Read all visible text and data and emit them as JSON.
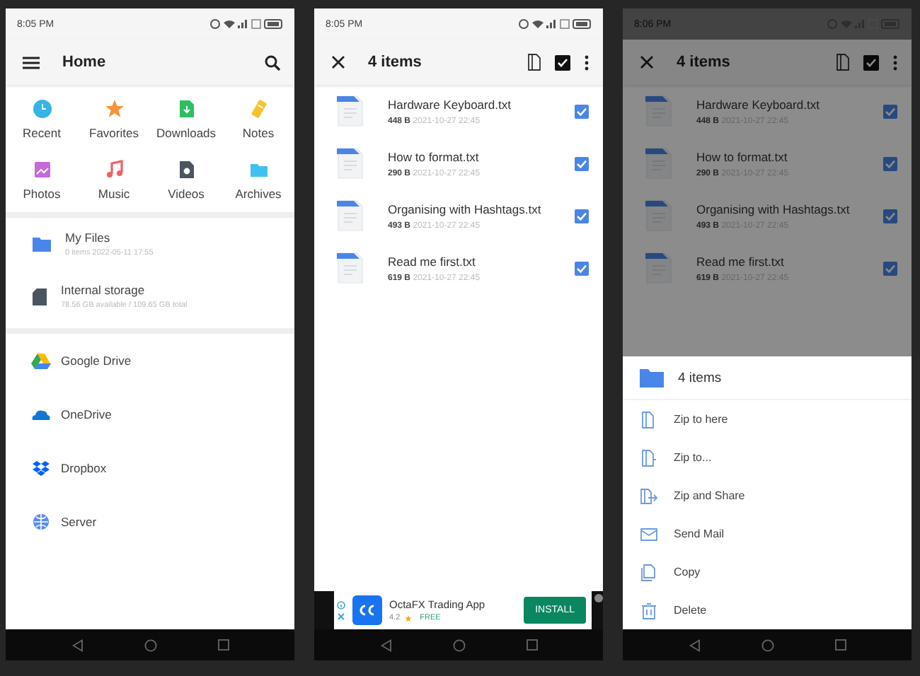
{
  "screens": [
    {
      "kind": "home",
      "time": "8:05 PM",
      "title": "Home",
      "categories": [
        {
          "label": "Recent"
        },
        {
          "label": "Favorites"
        },
        {
          "label": "Downloads"
        },
        {
          "label": "Notes"
        },
        {
          "label": "Photos"
        },
        {
          "label": "Music"
        },
        {
          "label": "Videos"
        },
        {
          "label": "Archives"
        }
      ],
      "locations": [
        {
          "name": "My Files",
          "detail": "0 items 2022-05-11 17:55"
        },
        {
          "name": "Internal storage",
          "detail": "78.56 GB available / 109.65 GB total"
        }
      ],
      "cloud": [
        {
          "name": "Google Drive"
        },
        {
          "name": "OneDrive"
        },
        {
          "name": "Dropbox"
        },
        {
          "name": "Server"
        }
      ]
    },
    {
      "kind": "selection",
      "time": "8:05 PM",
      "title": "4 items",
      "files": [
        {
          "name": "Hardware Keyboard.txt",
          "size": "448 B",
          "date": "2021-10-27 22:45",
          "checked": true
        },
        {
          "name": "How to format.txt",
          "size": "290 B",
          "date": "2021-10-27 22:45",
          "checked": true
        },
        {
          "name": "Organising with Hashtags.txt",
          "size": "493 B",
          "date": "2021-10-27 22:45",
          "checked": true
        },
        {
          "name": "Read me first.txt",
          "size": "619 B",
          "date": "2021-10-27 22:45",
          "checked": true
        }
      ],
      "ad": {
        "title": "OctaFX Trading App",
        "rating": "4.2",
        "price": "FREE",
        "button": "INSTALL"
      }
    },
    {
      "kind": "menu",
      "time": "8:06 PM",
      "title": "4 items",
      "files": [
        {
          "name": "Hardware Keyboard.txt",
          "size": "448 B",
          "date": "2021-10-27 22:45",
          "checked": true
        },
        {
          "name": "How to format.txt",
          "size": "290 B",
          "date": "2021-10-27 22:45",
          "checked": true
        },
        {
          "name": "Organising with Hashtags.txt",
          "size": "493 B",
          "date": "2021-10-27 22:45",
          "checked": true
        },
        {
          "name": "Read me first.txt",
          "size": "619 B",
          "date": "2021-10-27 22:45",
          "checked": true
        }
      ],
      "sheet": {
        "title": "4 items",
        "actions": [
          {
            "label": "Zip to here"
          },
          {
            "label": "Zip to..."
          },
          {
            "label": "Zip and Share"
          },
          {
            "label": "Send Mail"
          },
          {
            "label": "Copy"
          },
          {
            "label": "Delete"
          }
        ]
      }
    }
  ]
}
